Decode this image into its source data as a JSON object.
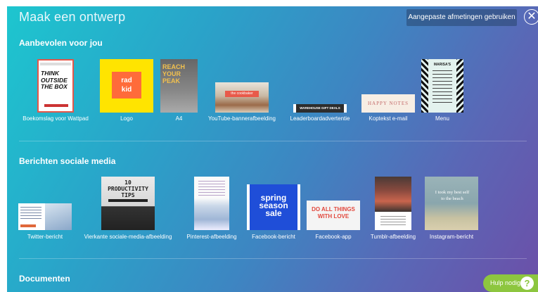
{
  "dialog": {
    "title": "Maak een ontwerp",
    "custom_size_label": "Aangepaste afmetingen gebruiken",
    "close_glyph": "✕"
  },
  "sections": [
    {
      "title": "Aanbevolen voor jou",
      "items": [
        {
          "label": "Boekomslag voor Wattpad",
          "thumb_text": "THINK OUTSIDE THE BOX"
        },
        {
          "label": "Logo",
          "thumb_text": "rad kid"
        },
        {
          "label": "A4",
          "thumb_text": "REACH YOUR PEAK"
        },
        {
          "label": "YouTube-bannerafbeelding",
          "thumb_text": "the cookbaker"
        },
        {
          "label": "Leaderboardadvertentie",
          "thumb_text": "WAREHOUSE GIFT DEALS"
        },
        {
          "label": "Koptekst e-mail",
          "thumb_text": "HAPPY NOTES"
        },
        {
          "label": "Menu",
          "thumb_text": "MARISA'S"
        }
      ]
    },
    {
      "title": "Berichten sociale media",
      "items": [
        {
          "label": "Twitter-bericht",
          "thumb_text": ""
        },
        {
          "label": "Vierkante sociale-media-afbeelding",
          "thumb_text": "10 PRODUCTIVITY TIPS"
        },
        {
          "label": "Pinterest-afbeelding",
          "thumb_text": ""
        },
        {
          "label": "Facebook-bericht",
          "thumb_text": "spring season sale"
        },
        {
          "label": "Facebook-app",
          "thumb_text": "DO ALL THINGS WITH LOVE"
        },
        {
          "label": "Tumblr-afbeelding",
          "thumb_text": ""
        },
        {
          "label": "Instagram-bericht",
          "thumb_text": "I took my best self to the beach"
        }
      ]
    },
    {
      "title": "Documenten",
      "items": []
    }
  ],
  "help": {
    "label": "Hulp nodig",
    "glyph": "?"
  }
}
